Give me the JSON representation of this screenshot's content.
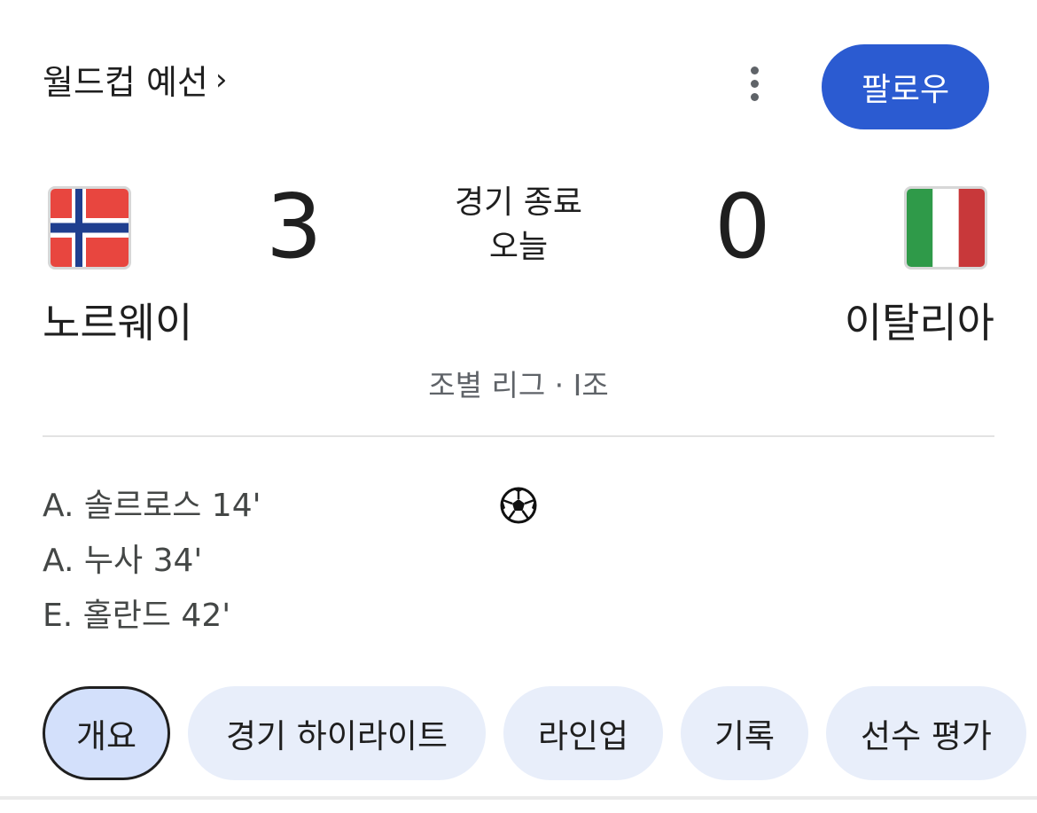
{
  "header": {
    "title": "월드컵 예선",
    "chevron": "›",
    "follow_label": "팔로우",
    "more_icon": "more-vertical-icon"
  },
  "match": {
    "home": {
      "name": "노르웨이",
      "score": "3",
      "flag": "norway-flag"
    },
    "away": {
      "name": "이탈리아",
      "score": "0",
      "flag": "italy-flag"
    },
    "status": "경기 종료",
    "date": "오늘",
    "league": "조별 리그 · I조"
  },
  "goals": [
    {
      "text": "A. 솔르로스 14'"
    },
    {
      "text": "A. 누사 34'"
    },
    {
      "text": "E. 홀란드 42'"
    }
  ],
  "goal_icon": "soccer-ball-icon",
  "tabs": [
    {
      "label": "개요",
      "active": true
    },
    {
      "label": "경기 하이라이트"
    },
    {
      "label": "라인업"
    },
    {
      "label": "기록"
    },
    {
      "label": "선수 평가"
    }
  ],
  "colors": {
    "follow_button": "#2b5bd1",
    "tab_bg": "#e8eefa",
    "tab_active_bg": "#d3e0fb"
  }
}
